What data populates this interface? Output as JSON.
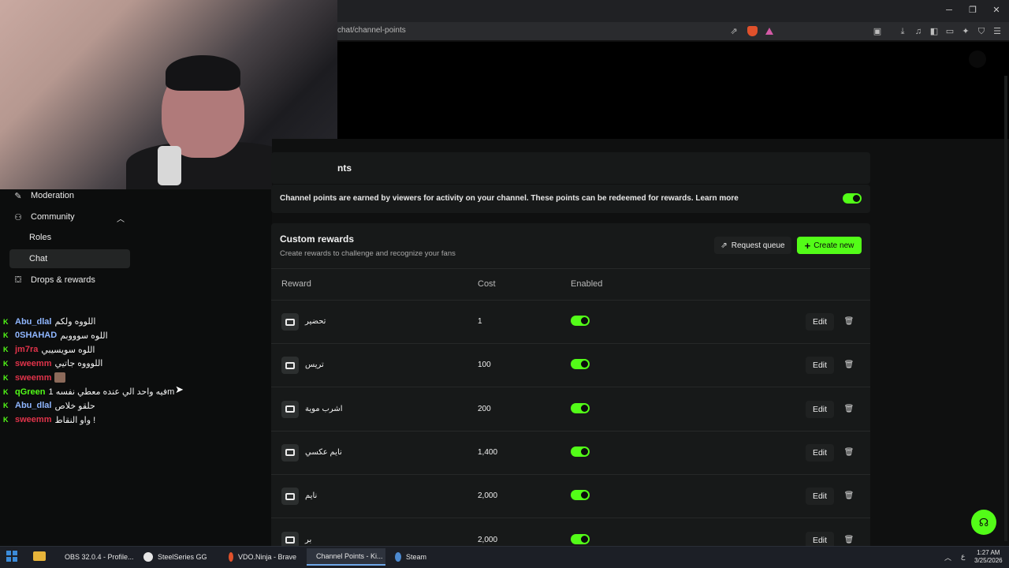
{
  "browser": {
    "url": "chat/channel-points",
    "window_controls": [
      "─",
      "❐",
      "✕"
    ]
  },
  "sidebar": {
    "items": [
      {
        "label": "Moderation",
        "icon": "wrench-icon",
        "glyph": "🔧"
      },
      {
        "label": "Community",
        "icon": "users-icon",
        "glyph": "👥"
      },
      {
        "label": "Roles",
        "icon": "",
        "glyph": ""
      },
      {
        "label": "Chat",
        "icon": "",
        "glyph": ""
      },
      {
        "label": "Drops & rewards",
        "icon": "gift-icon",
        "glyph": "🎁"
      }
    ]
  },
  "chat": [
    {
      "user": "Abu_dlal",
      "color": "#8fb6ff",
      "msg": "اللووه ولكم"
    },
    {
      "user": "0SHAHAD",
      "color": "#8fb6ff",
      "msg": "اللوه سوووبم"
    },
    {
      "user": "jm7ra",
      "color": "#e0334a",
      "msg": "اللوه سويسيبي"
    },
    {
      "user": "sweemm",
      "color": "#e0334a",
      "msg": "اللوووه جاتيي"
    },
    {
      "user": "sweemm",
      "color": "#e0334a",
      "msg": ""
    },
    {
      "user": "qGreen",
      "color": "#53fc18",
      "msg": "فيه واحد الي عنده معطي نفسه 1m"
    },
    {
      "user": "Abu_dlal",
      "color": "#8fb6ff",
      "msg": "حلقو خلاص"
    },
    {
      "user": "sweemm",
      "color": "#e0334a",
      "msg": "واو النقاط !"
    }
  ],
  "channel_points": {
    "title_fragment": "nts",
    "description": "Channel points are earned by viewers for activity on your channel. These points can be redeemed for rewards.",
    "learn_more": "Learn more",
    "enabled": true
  },
  "custom_rewards": {
    "title": "Custom rewards",
    "subtitle": "Create rewards to challenge and recognize your fans",
    "request_queue_label": "Request queue",
    "create_new_label": "Create new",
    "columns": [
      "Reward",
      "Cost",
      "Enabled"
    ],
    "edit_label": "Edit",
    "rows": [
      {
        "name": "تحضير",
        "cost": "1",
        "enabled": true
      },
      {
        "name": "تريس",
        "cost": "100",
        "enabled": true
      },
      {
        "name": "اشرب موية",
        "cost": "200",
        "enabled": true
      },
      {
        "name": "نايم عكسي",
        "cost": "1,400",
        "enabled": true
      },
      {
        "name": "نايم",
        "cost": "2,000",
        "enabled": true
      },
      {
        "name": "بر",
        "cost": "2,000",
        "enabled": true
      }
    ]
  },
  "taskbar": {
    "apps": [
      {
        "label": "OBS 32.0.4 - Profile...",
        "color": "#2b2b2b",
        "active": false
      },
      {
        "label": "SteelSeries GG",
        "color": "#e6e6e6",
        "active": false
      },
      {
        "label": "VDO.Ninja - Brave",
        "color": "#e0512b",
        "active": false
      },
      {
        "label": "Channel Points - Ki...",
        "color": "#e0512b",
        "active": true
      },
      {
        "label": "Steam",
        "color": "#4d8ad0",
        "active": false
      }
    ],
    "time": "1:27 AM",
    "date": "3/25/2026",
    "lang": "ع"
  },
  "accent_color": "#53fc18"
}
